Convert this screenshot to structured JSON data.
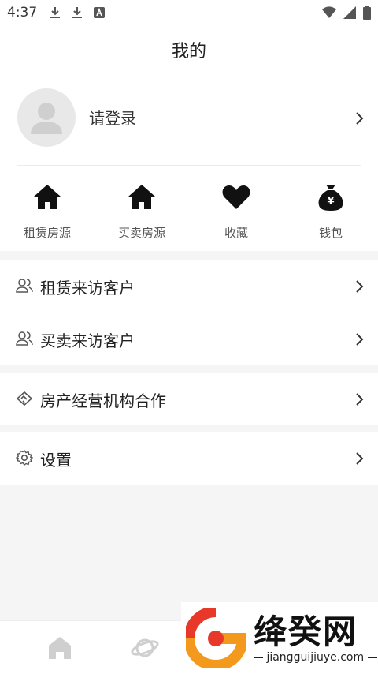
{
  "status_bar": {
    "time": "4:37",
    "left_icons": [
      "download-icon",
      "download-icon",
      "a-icon"
    ],
    "right_icons": [
      "wifi-icon",
      "signal-icon",
      "battery-icon"
    ]
  },
  "header": {
    "title": "我的"
  },
  "profile": {
    "login_label": "请登录"
  },
  "quick_actions": [
    {
      "label": "租赁房源",
      "icon": "house-icon"
    },
    {
      "label": "买卖房源",
      "icon": "house-icon"
    },
    {
      "label": "收藏",
      "icon": "heart-icon"
    },
    {
      "label": "钱包",
      "icon": "money-bag-icon"
    }
  ],
  "menu_group_1": [
    {
      "label": "租赁来访客户",
      "icon": "users-icon"
    },
    {
      "label": "买卖来访客户",
      "icon": "users-icon"
    }
  ],
  "menu_group_2": [
    {
      "label": "房产经营机构合作",
      "icon": "handshake-icon"
    }
  ],
  "menu_group_3": [
    {
      "label": "设置",
      "icon": "gear-icon"
    }
  ],
  "tab_bar": {
    "tabs": [
      "home-tab-icon",
      "planet-tab-icon"
    ]
  },
  "watermark": {
    "name": "绛癸网",
    "url": "jiangguijiuye.com"
  },
  "colors": {
    "accent": "#222222",
    "watermark_orange": "#f39a1e",
    "watermark_red": "#e8382a"
  }
}
